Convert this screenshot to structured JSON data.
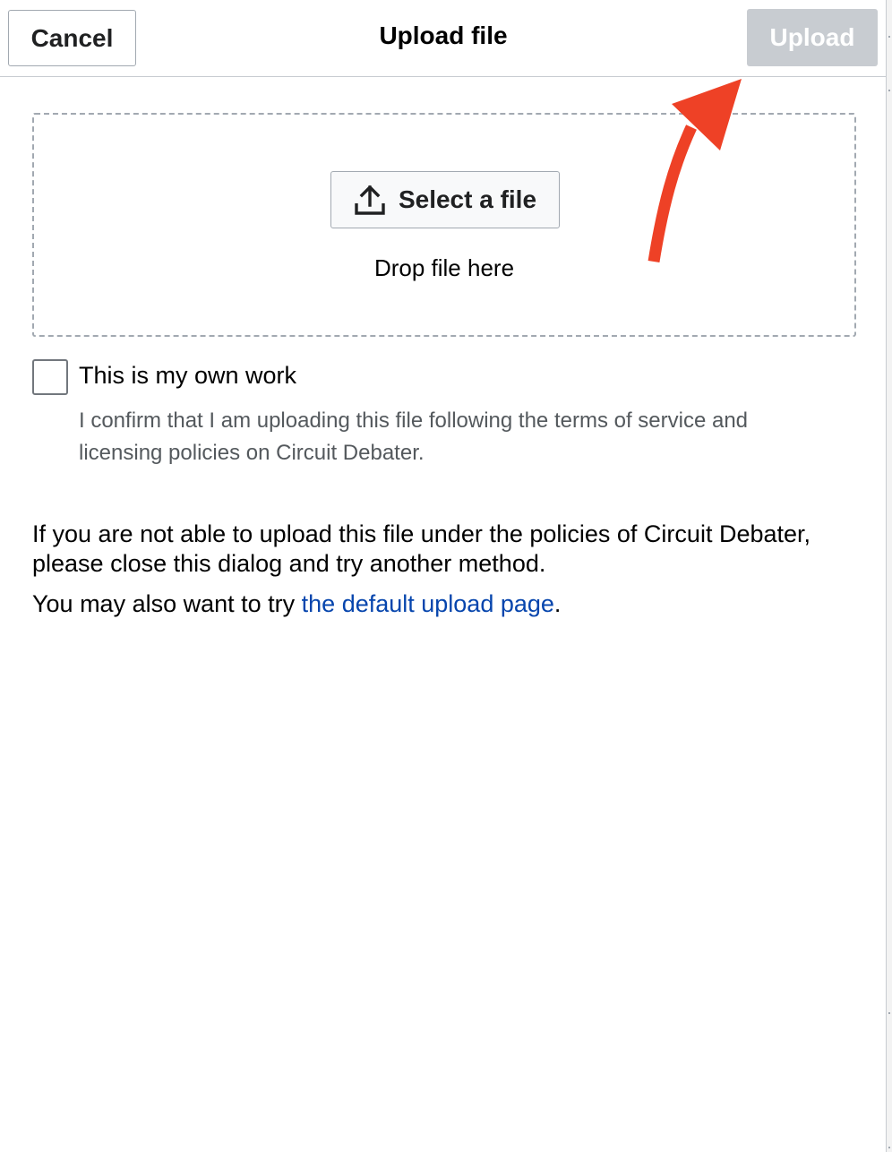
{
  "header": {
    "cancel_label": "Cancel",
    "title": "Upload file",
    "upload_label": "Upload"
  },
  "dropzone": {
    "select_label": "Select a file",
    "drop_text": "Drop file here"
  },
  "own_work": {
    "label": "This is my own work",
    "checked": false,
    "help": "I confirm that I am uploading this file following the terms of service and licensing policies on Circuit Debater."
  },
  "policy_text": "If you are not able to upload this file under the policies of Circuit Debater, please close this dialog and try another method.",
  "alternative": {
    "prefix": "You may also want to try ",
    "link_text": "the default upload page",
    "suffix": "."
  },
  "colors": {
    "link": "#0645ad",
    "disabled_button": "#c8ccd1",
    "annotation_arrow": "#ee4126"
  }
}
